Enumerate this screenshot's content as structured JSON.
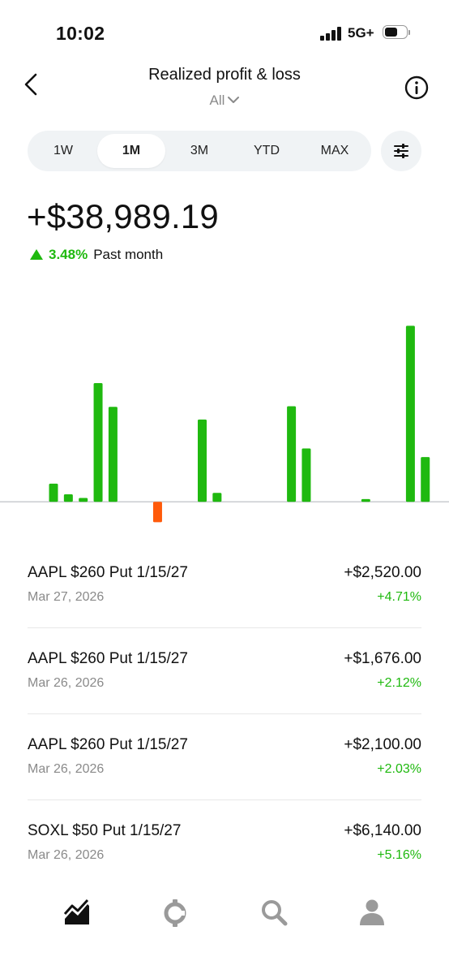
{
  "status_bar": {
    "time": "10:02",
    "network": "5G+",
    "signal_bars": 4,
    "battery_level": 0.55
  },
  "header": {
    "title": "Realized profit & loss",
    "filter_label": "All"
  },
  "range": {
    "tabs": [
      {
        "label": "1W",
        "active": false
      },
      {
        "label": "1M",
        "active": true
      },
      {
        "label": "3M",
        "active": false
      },
      {
        "label": "YTD",
        "active": false
      },
      {
        "label": "MAX",
        "active": false
      }
    ]
  },
  "summary": {
    "total": "+$38,989.19",
    "change_pct": "3.48%",
    "period": "Past month"
  },
  "colors": {
    "positive": "#1fb90f",
    "negative": "#ff5a0a",
    "baseline": "#c9ccd0"
  },
  "chart_data": {
    "type": "bar",
    "x": [
      1,
      2,
      3,
      4,
      5,
      6,
      7,
      8,
      9,
      10,
      11,
      12,
      13,
      14,
      15,
      16,
      17,
      18,
      19,
      20,
      21,
      22,
      23,
      24,
      25,
      26,
      27,
      28
    ],
    "values": [
      0,
      0,
      0,
      0,
      0,
      0.85,
      0.35,
      0.18,
      5.54,
      4.43,
      0,
      0,
      0,
      0,
      0,
      0,
      0,
      0,
      0,
      0,
      0,
      0,
      0,
      0,
      0,
      0,
      0,
      0
    ],
    "series": [
      {
        "name": "",
        "values": [
          0,
          0,
          0,
          0,
          0,
          0,
          0,
          0,
          0,
          0,
          0,
          0,
          0,
          0,
          0,
          0,
          0,
          0,
          0,
          0,
          0,
          0,
          0,
          0,
          0,
          0,
          0,
          0
        ]
      }
    ],
    "bars": [
      {
        "index": 3,
        "value": 0.85
      },
      {
        "index": 4,
        "value": 0.35
      },
      {
        "index": 5,
        "value": 0.18
      },
      {
        "index": 6,
        "value": 5.54
      },
      {
        "index": 7,
        "value": 4.43
      },
      {
        "index": 10,
        "value": -0.95
      },
      {
        "index": 13,
        "value": 3.84
      },
      {
        "index": 14,
        "value": 0.42
      },
      {
        "index": 19,
        "value": 4.46
      },
      {
        "index": 20,
        "value": 2.49
      },
      {
        "index": 24,
        "value": 0.13
      },
      {
        "index": 27,
        "value": 8.21
      },
      {
        "index": 28,
        "value": 2.09
      }
    ],
    "ylim": [
      -1.2,
      9.4
    ],
    "grid": false,
    "title": "",
    "xlabel": "",
    "ylabel": ""
  },
  "trades": [
    {
      "name": "AAPL $260 Put 1/15/27",
      "date": "Mar 27, 2026",
      "amount": "+$2,520.00",
      "pct": "+4.71%"
    },
    {
      "name": "AAPL $260 Put 1/15/27",
      "date": "Mar 26, 2026",
      "amount": "+$1,676.00",
      "pct": "+2.12%"
    },
    {
      "name": "AAPL $260 Put 1/15/27",
      "date": "Mar 26, 2026",
      "amount": "+$2,100.00",
      "pct": "+2.03%"
    },
    {
      "name": "SOXL $50 Put 1/15/27",
      "date": "Mar 26, 2026",
      "amount": "+$6,140.00",
      "pct": "+5.16%"
    }
  ],
  "nav": {
    "items": [
      {
        "icon": "investing-icon",
        "active": true
      },
      {
        "icon": "crypto-icon",
        "active": false
      },
      {
        "icon": "search-icon",
        "active": false
      },
      {
        "icon": "account-icon",
        "active": false
      }
    ]
  }
}
